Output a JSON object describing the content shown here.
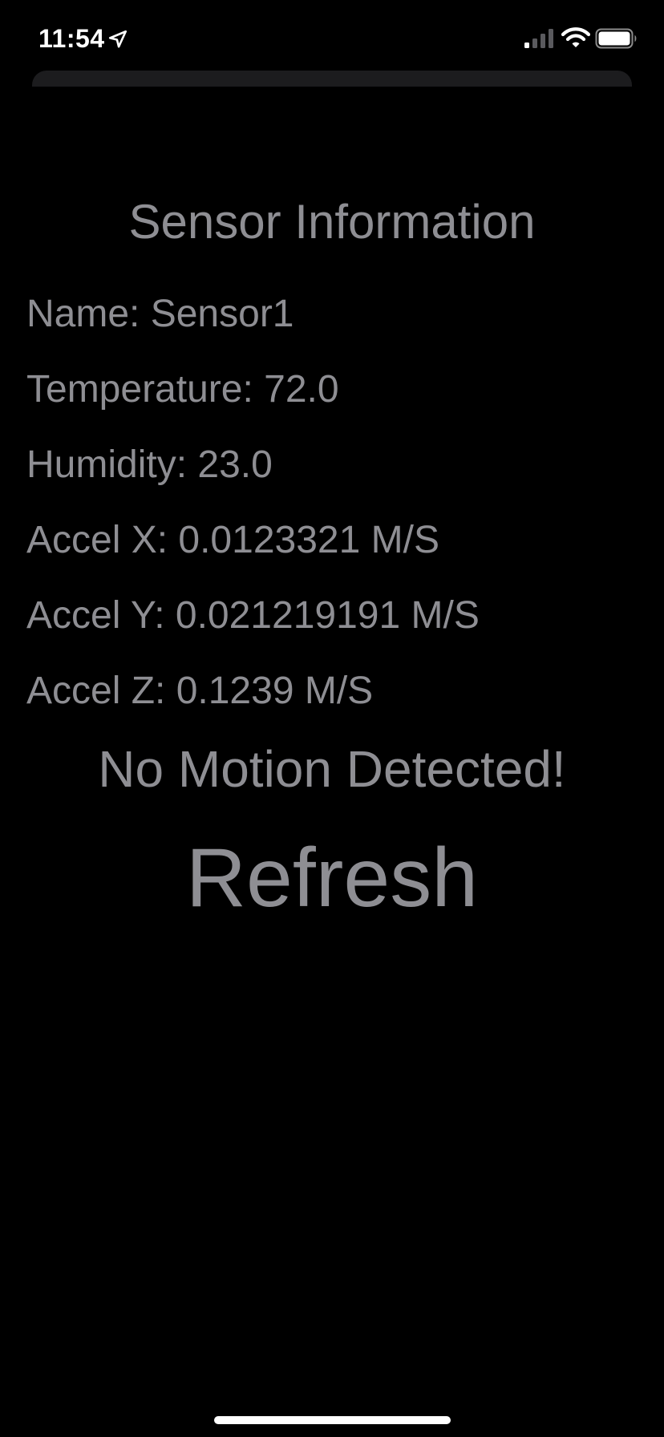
{
  "status_bar": {
    "time": "11:54",
    "icons": [
      "location-arrow-icon",
      "cellular-signal-icon",
      "wifi-icon",
      "battery-icon"
    ]
  },
  "screen": {
    "title": "Sensor Information",
    "lines": {
      "name": "Name: Sensor1",
      "temperature": "Temperature: 72.0",
      "humidity": "Humidity: 23.0",
      "accel_x": "Accel X: 0.0123321 M/S",
      "accel_y": "Accel Y: 0.021219191 M/S",
      "accel_z": "Accel Z: 0.1239 M/S"
    },
    "motion_status": "No Motion Detected!",
    "refresh_label": "Refresh"
  },
  "colors": {
    "background": "#000000",
    "text": "#8E8E93",
    "sheet": "#1C1C1E",
    "status_bar_text": "#FFFFFF"
  }
}
